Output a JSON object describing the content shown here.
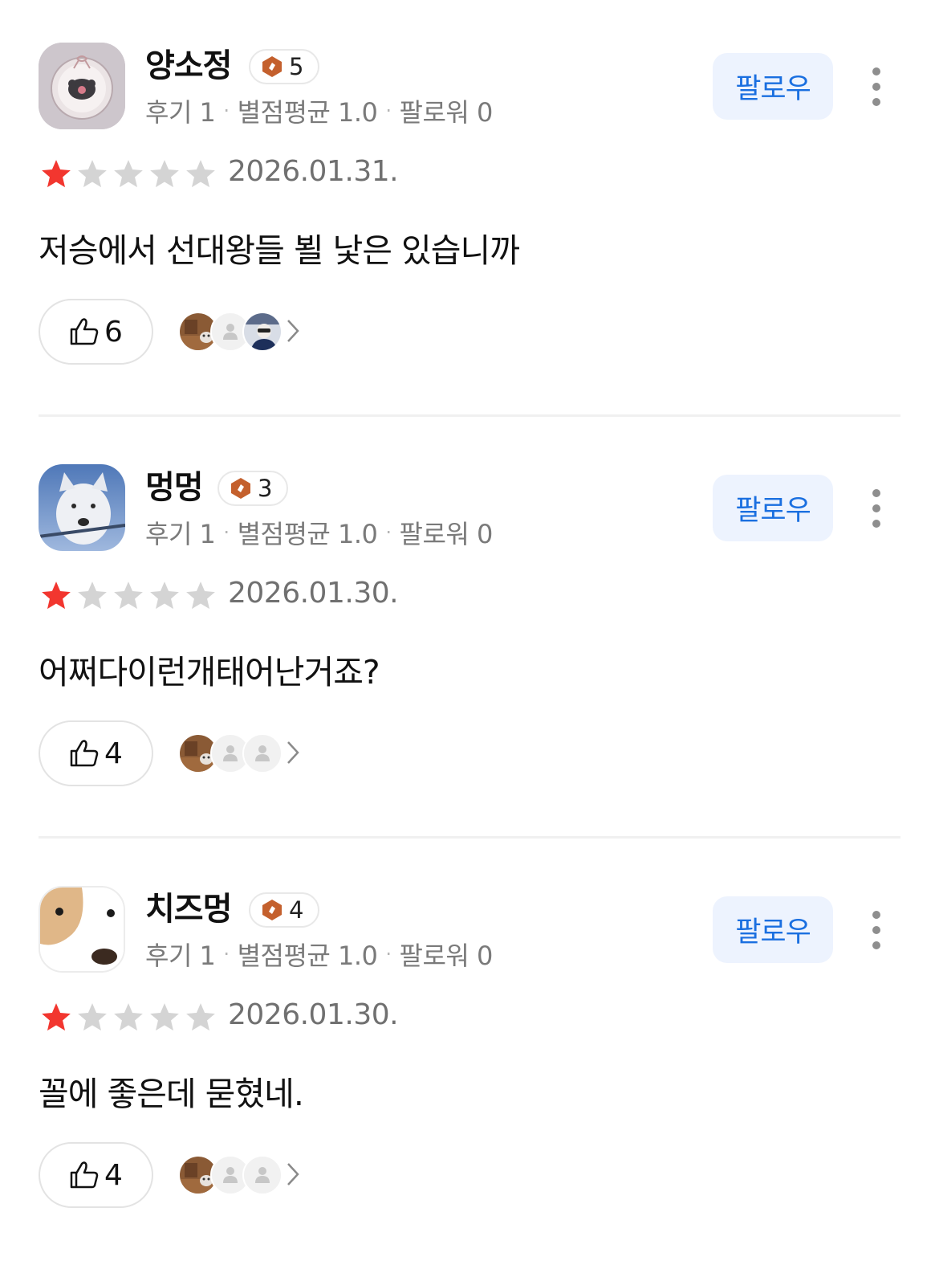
{
  "follow_label": "팔로우",
  "reviews": [
    {
      "user": {
        "name": "양소정",
        "level": "5",
        "avatar_icon": "sheep-plush-icon"
      },
      "stats": {
        "reviews": "후기 1",
        "rating_avg": "별점평균 1.0",
        "followers": "팔로워 0"
      },
      "rating": 1,
      "date": "2026.01.31.",
      "text": "저승에서 선대왕들 뵐 낯은 있습니까",
      "likes": "6",
      "likers": [
        "cat-photo",
        "placeholder",
        "person-photo"
      ]
    },
    {
      "user": {
        "name": "멍멍",
        "level": "3",
        "avatar_icon": "dog-photo-icon"
      },
      "stats": {
        "reviews": "후기 1",
        "rating_avg": "별점평균 1.0",
        "followers": "팔로워 0"
      },
      "rating": 1,
      "date": "2026.01.30.",
      "text": "어쩌다이런개태어난거죠?",
      "likes": "4",
      "likers": [
        "cat-photo",
        "placeholder",
        "placeholder"
      ]
    },
    {
      "user": {
        "name": "치즈멍",
        "level": "4",
        "avatar_icon": "cartoon-dog-icon"
      },
      "stats": {
        "reviews": "후기 1",
        "rating_avg": "별점평균 1.0",
        "followers": "팔로워 0"
      },
      "rating": 1,
      "date": "2026.01.30.",
      "text": "꼴에 좋은데 묻혔네.",
      "likes": "4",
      "likers": [
        "cat-photo",
        "placeholder",
        "placeholder"
      ]
    }
  ],
  "colors": {
    "accent": "#1a6fe0",
    "follow_bg": "#edf3fe",
    "star_filled": "#f2362f",
    "star_empty": "#d4d4d4",
    "level_badge": "#c4602d"
  }
}
